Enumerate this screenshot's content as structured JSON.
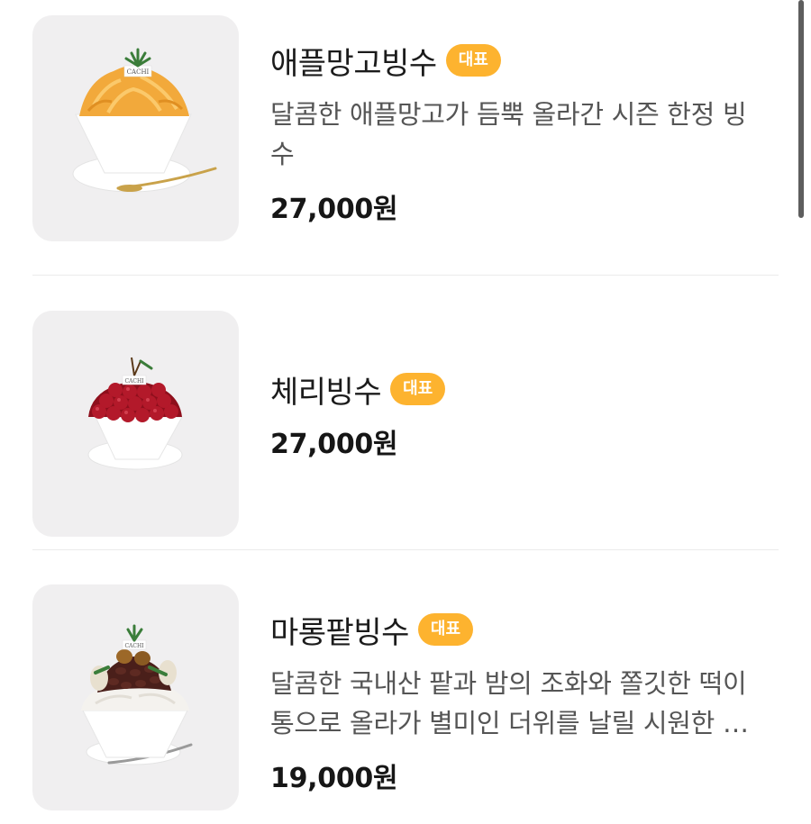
{
  "menu": {
    "items": [
      {
        "name": "애플망고빙수",
        "badge": "대표",
        "description": "달콤한 애플망고가 듬뿍 올라간 시즌 한정 빙수",
        "price": "27,000원",
        "image_icon": "mango-bingsu-image"
      },
      {
        "name": "체리빙수",
        "badge": "대표",
        "description": "",
        "price": "27,000원",
        "image_icon": "cherry-bingsu-image"
      },
      {
        "name": "마롱팥빙수",
        "badge": "대표",
        "description": "달콤한 국내산 팥과 밤의 조화와 쫄깃한 떡이 통으로 올라가 별미인 더위를 날릴 시원한 빙수",
        "price": "19,000원",
        "image_icon": "marron-red-bean-bingsu-image"
      }
    ],
    "logo_text": "CACHI"
  },
  "colors": {
    "badge": "#fdb32f",
    "thumb_bg": "#f0eff0",
    "text": "#1b1b1b",
    "description": "#555555"
  }
}
